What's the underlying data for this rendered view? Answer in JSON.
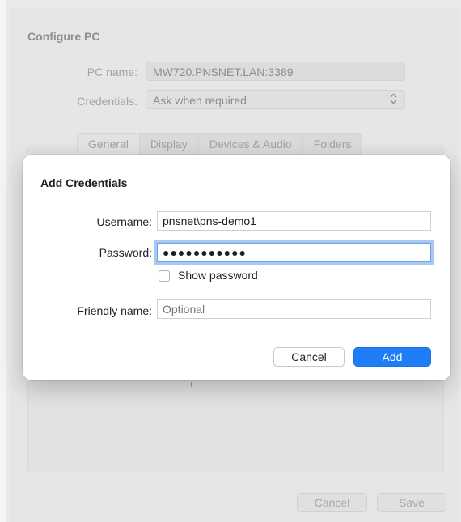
{
  "background": {
    "title": "Configure PC",
    "pc_name_label": "PC name:",
    "pc_name_value": "MW720.PNSNET.LAN:3389",
    "credentials_label": "Credentials:",
    "credentials_value": "Ask when required",
    "tabs": [
      "General",
      "Display",
      "Devices & Audio",
      "Folders"
    ],
    "cancel_label": "Cancel",
    "save_label": "Save"
  },
  "dialog": {
    "title": "Add Credentials",
    "username_label": "Username:",
    "username_value": "pnsnet\\pns-demo1",
    "password_label": "Password:",
    "password_masked": "●●●●●●●●●●●",
    "show_password_label": "Show password",
    "show_password_checked": false,
    "friendly_name_label": "Friendly name:",
    "friendly_name_placeholder": "Optional",
    "cancel_label": "Cancel",
    "add_label": "Add"
  },
  "colors": {
    "accent": "#1f7ef7",
    "focus_ring": "#a9c9f3"
  },
  "icons": {
    "select_arrow": "chevron-up-down-icon"
  }
}
